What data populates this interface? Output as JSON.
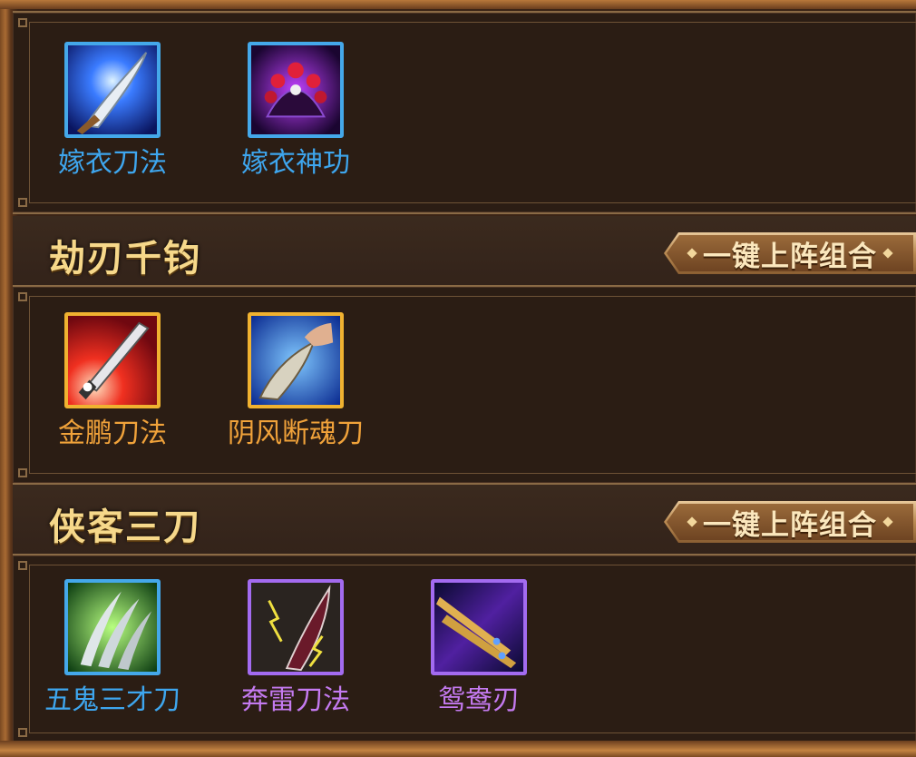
{
  "sections": [
    {
      "title": "",
      "skills": [
        {
          "name": "嫁衣刀法",
          "icon": "blade-light-icon",
          "rarity": "blue"
        },
        {
          "name": "嫁衣神功",
          "icon": "phoenix-crown-icon",
          "rarity": "blue"
        }
      ]
    },
    {
      "title": "劫刃千钧",
      "button": "一键上阵组合",
      "skills": [
        {
          "name": "金鹏刀法",
          "icon": "red-blade-icon",
          "rarity": "orange"
        },
        {
          "name": "阴风断魂刀",
          "icon": "hand-blade-icon",
          "rarity": "orange"
        }
      ]
    },
    {
      "title": "侠客三刀",
      "button": "一键上阵组合",
      "skills": [
        {
          "name": "五鬼三才刀",
          "icon": "triple-claw-icon",
          "rarity": "blue"
        },
        {
          "name": "奔雷刀法",
          "icon": "thunder-blade-icon",
          "rarity": "purple"
        },
        {
          "name": "鸳鸯刃",
          "icon": "twin-blades-icon",
          "rarity": "purple"
        }
      ]
    }
  ],
  "colors": {
    "blue": "#3ea6ee",
    "orange": "#f0a23a",
    "purple": "#c47af0",
    "title": "#f6d88a"
  }
}
